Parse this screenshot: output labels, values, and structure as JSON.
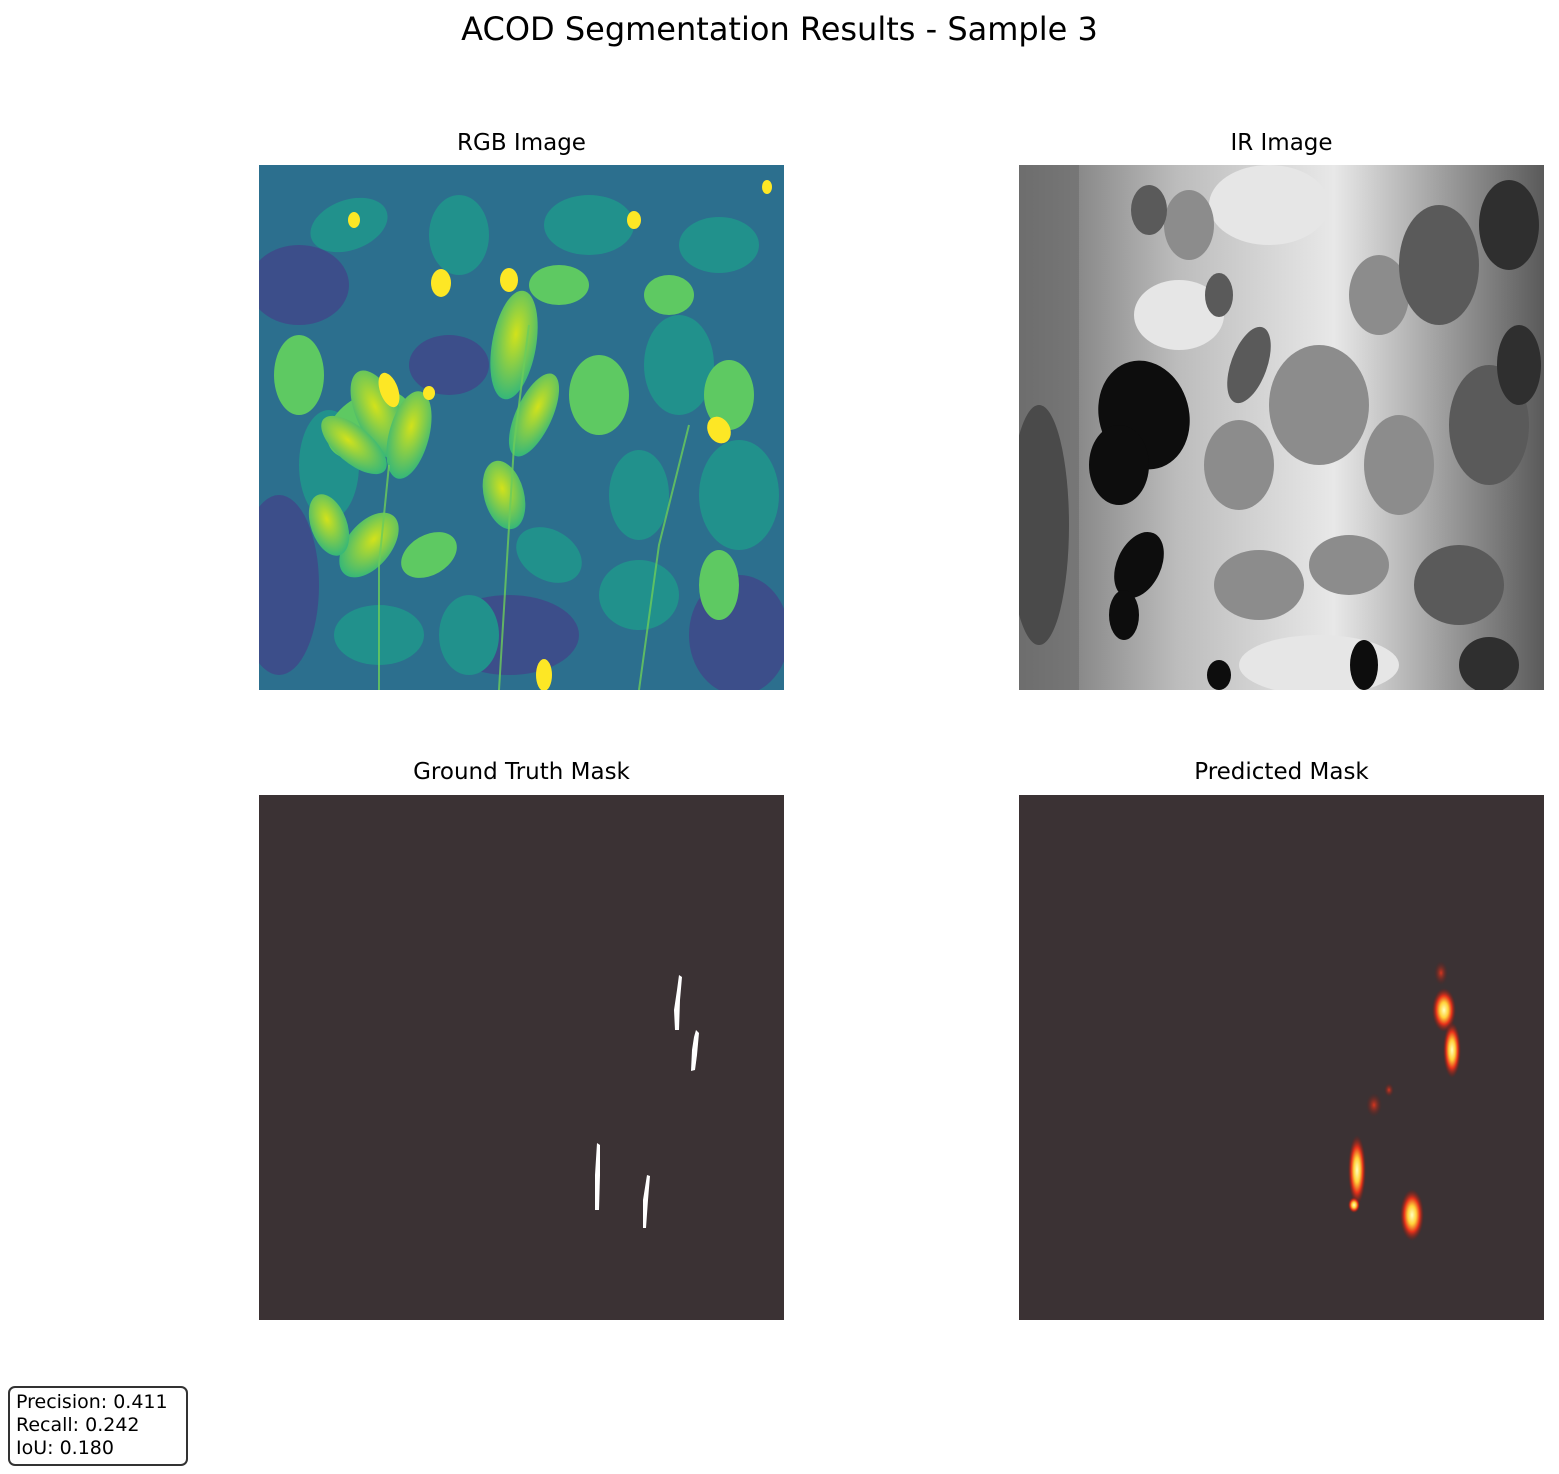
{
  "figure": {
    "title": "ACOD Segmentation Results - Sample 3"
  },
  "panels": {
    "rgb": {
      "title": "RGB Image",
      "colormap": "viridis"
    },
    "ir": {
      "title": "IR Image",
      "colormap": "gray"
    },
    "gt": {
      "title": "Ground Truth Mask",
      "background": "#3b3234",
      "foreground": "#ffffff"
    },
    "pred": {
      "title": "Predicted Mask",
      "background": "#3b3234",
      "colormap": "hot"
    }
  },
  "metrics": {
    "precision": "Precision: 0.411",
    "recall": "Recall: 0.242",
    "iou": "IoU: 0.180"
  }
}
